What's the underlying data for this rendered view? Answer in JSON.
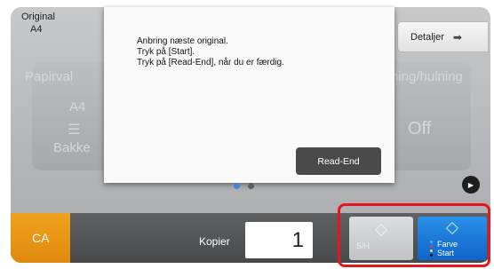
{
  "header": {
    "original_label": "Original",
    "original_size": "A4",
    "details_button": "Detaljer"
  },
  "background": {
    "left_card_title": "Papirval",
    "left_card_size": "A4",
    "left_card_tray": "Bakke",
    "right_card_title": "hing/hulning",
    "right_card_value": "Off"
  },
  "dialog": {
    "lines": [
      "Anbring næste original.",
      "Tryk på [Start].",
      "Tryk på [Read-End], når du er færdig."
    ],
    "read_end_button": "Read-End"
  },
  "bottom": {
    "ca_button": "CA",
    "copies_label": "Kopier",
    "copies_value": "1",
    "bw_start_label": "S/H",
    "color_start_label_1": "Farve",
    "color_start_label_2": "Start"
  },
  "pagination": {
    "current_page": 1,
    "total_pages": 2
  },
  "colors": {
    "accent_orange": "#e8941a",
    "start_blue": "#1a76d8",
    "highlight_red": "#e8151f",
    "active_dot": "#3b86d8"
  }
}
